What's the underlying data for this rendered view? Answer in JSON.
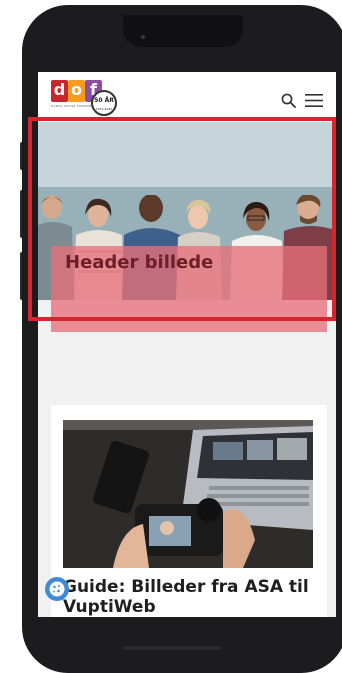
{
  "logo": {
    "letters": [
      "d",
      "o",
      "f"
    ],
    "tagline": "DANSK OPTISK FORENING",
    "badge_main": "50 ÅR",
    "badge_sub": "1972-2022"
  },
  "header": {
    "search_icon": "search-icon",
    "menu_icon": "hamburger-menu-icon"
  },
  "hero": {
    "caption": "Header billede",
    "highlight_color": "#d5262d",
    "overlay_color": "#e77078"
  },
  "article": {
    "title": "Guide: Billeder fra ASA til VuptiWeb"
  },
  "cookie": {
    "icon": "cookie-icon"
  }
}
